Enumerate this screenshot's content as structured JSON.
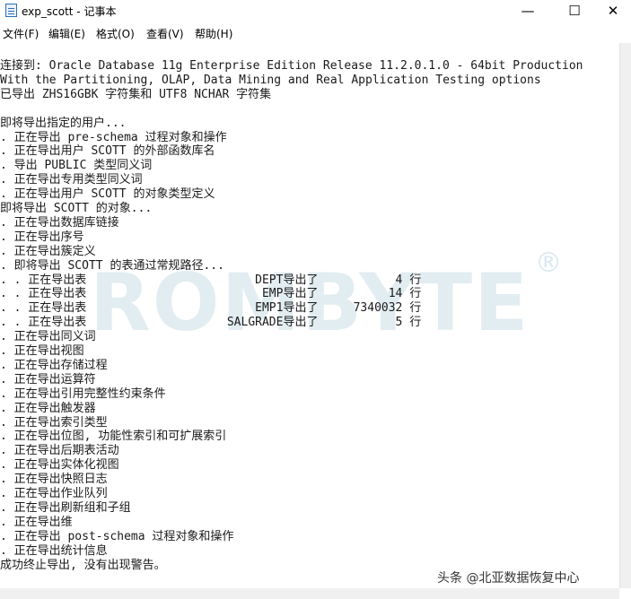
{
  "window": {
    "title": "exp_scott - 记事本",
    "min_glyph": "—",
    "max_glyph": "☐",
    "close_glyph": "✕"
  },
  "menu": [
    "文件(F)",
    "编辑(E)",
    "格式(O)",
    "查看(V)",
    "帮助(H)"
  ],
  "editor": {
    "lines": [
      "连接到: Oracle Database 11g Enterprise Edition Release 11.2.0.1.0 - 64bit Production",
      "With the Partitioning, OLAP, Data Mining and Real Application Testing options",
      "已导出 ZHS16GBK 字符集和 UTF8 NCHAR 字符集",
      "",
      "即将导出指定的用户...",
      ". 正在导出 pre-schema 过程对象和操作",
      ". 正在导出用户 SCOTT 的外部函数库名",
      ". 导出 PUBLIC 类型同义词",
      ". 正在导出专用类型同义词",
      ". 正在导出用户 SCOTT 的对象类型定义",
      "即将导出 SCOTT 的对象...",
      ". 正在导出数据库链接",
      ". 正在导出序号",
      ". 正在导出簇定义",
      ". 即将导出 SCOTT 的表通过常规路径...",
      ". . 正在导出表                        DEPT导出了           4 行",
      ". . 正在导出表                         EMP导出了          14 行",
      ". . 正在导出表                        EMP1导出了     7340032 行",
      ". . 正在导出表                    SALGRADE导出了           5 行",
      ". 正在导出同义词",
      ". 正在导出视图",
      ". 正在导出存储过程",
      ". 正在导出运算符",
      ". 正在导出引用完整性约束条件",
      ". 正在导出触发器",
      ". 正在导出索引类型",
      ". 正在导出位图, 功能性索引和可扩展索引",
      ". 正在导出后期表活动",
      ". 正在导出实体化视图",
      ". 正在导出快照日志",
      ". 正在导出作业队列",
      ". 正在导出刷新组和子组",
      ". 正在导出维",
      ". 正在导出 post-schema 过程对象和操作",
      ". 正在导出统计信息",
      "成功终止导出, 没有出现警告。"
    ]
  },
  "watermark": {
    "text": "ROMBYTE",
    "registered": "®"
  },
  "credit": "头条 @北亚数据恢复中心"
}
